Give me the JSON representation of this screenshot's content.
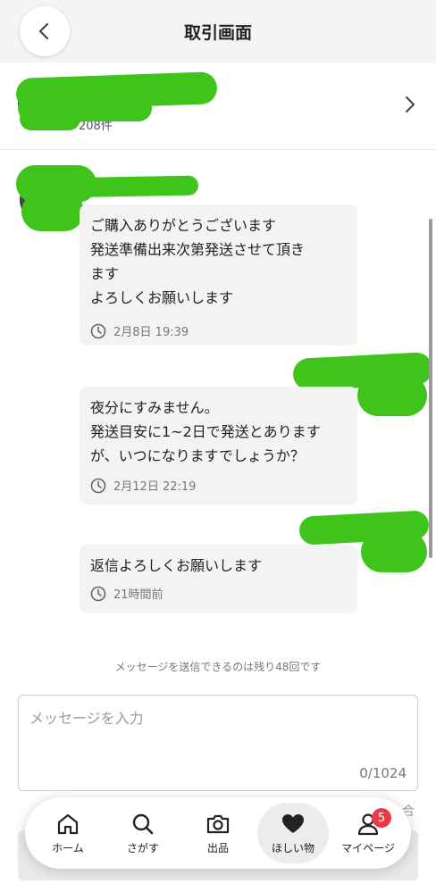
{
  "header": {
    "title": "取引画面"
  },
  "seller": {
    "stars": "★★★★★",
    "review_count": "208件",
    "star_color": "#f5b400"
  },
  "messages": [
    {
      "text": "ご購入ありがとうございます\n発送準備出来次第発送させて頂き\nます\nよろしくお願いします",
      "timestamp": "2月8日 19:39"
    },
    {
      "text": "夜分にすみません。\n発送目安に1~2日で発送とありますが、いつになりますでしょうか？",
      "timestamp": "2月12日 22:19"
    },
    {
      "text": "返信よろしくお願いします",
      "timestamp": "21時間前"
    }
  ],
  "remaining_notice": "メッセージを送信できるのは残り48回です",
  "composer": {
    "placeholder": "メッセージを入力",
    "counter": "0/1024"
  },
  "behind_text": "合",
  "nav": {
    "home": "ホーム",
    "search": "さがす",
    "sell": "出品",
    "wishlist": "ほしい物",
    "mypage": "マイページ",
    "mypage_badge": "5"
  },
  "colors": {
    "badge": "#e93a45",
    "redaction": "#3fc41c"
  }
}
